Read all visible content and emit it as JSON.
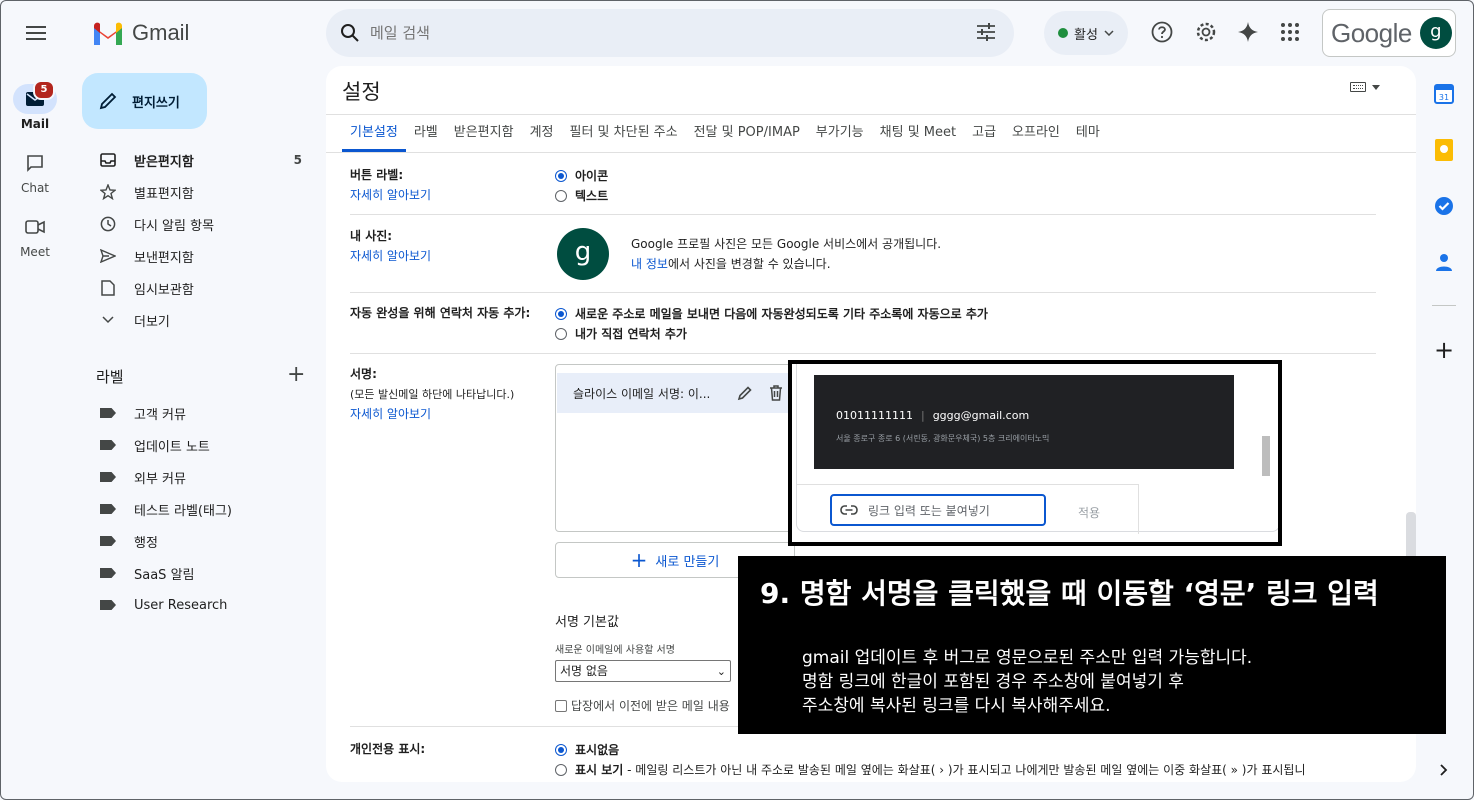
{
  "brand": {
    "name": "Gmail"
  },
  "rail": [
    {
      "label": "Mail",
      "badge": "5"
    },
    {
      "label": "Chat"
    },
    {
      "label": "Meet"
    }
  ],
  "search": {
    "placeholder": "메일 검색"
  },
  "status": {
    "label": "활성"
  },
  "account": {
    "google_word": "Google",
    "avatar_letter": "g"
  },
  "compose": {
    "label": "편지쓰기"
  },
  "nav": {
    "items": [
      {
        "label": "받은편지함",
        "count": "5"
      },
      {
        "label": "별표편지함"
      },
      {
        "label": "다시 알림 항목"
      },
      {
        "label": "보낸편지함"
      },
      {
        "label": "임시보관함"
      },
      {
        "label": "더보기"
      }
    ],
    "labels_header": "라벨",
    "labels": [
      "고객 커뮤",
      "업데이트 노트",
      "외부 커뮤",
      "테스트 라벨(태그)",
      "행정",
      "SaaS 알림",
      "User Research"
    ]
  },
  "settings": {
    "title": "설정",
    "tabs": [
      "기본설정",
      "라벨",
      "받은편지함",
      "계정",
      "필터 및 차단된 주소",
      "전달 및 POP/IMAP",
      "부가기능",
      "채팅 및 Meet",
      "고급",
      "오프라인",
      "테마"
    ],
    "learn_more": "자세히 알아보기",
    "button_label": {
      "title": "버튼 라벨:",
      "opt1": "아이콘",
      "opt2": "텍스트"
    },
    "photo": {
      "title": "내 사진:",
      "letter": "g",
      "line1": "Google 프로필 사진은 모든 Google 서비스에서 공개됩니다.",
      "link": "내 정보",
      "line2_rest": "에서 사진을 변경할 수 있습니다."
    },
    "autocomplete": {
      "title": "자동 완성을 위해 연락처 자동 추가:",
      "opt1": "새로운 주소로 메일을 보내면 다음에 자동완성되도록 기타 주소록에 자동으로 추가",
      "opt2": "내가 직접 연락처 추가"
    },
    "signature": {
      "title": "서명:",
      "subtitle": "(모든 발신메일 하단에 나타납니다.)",
      "item": "슬라이스 이메일 서명: 이...",
      "new_button": "새로 만들기",
      "defaults_title": "서명 기본값",
      "defaults_note": "새로운 이메일에 사용할 서명",
      "select_value": "서명 없음",
      "reply_checkbox": "답장에서 이전에 받은 메일 내용"
    },
    "personal": {
      "title": "개인전용 표시:",
      "opt1": "표시없음",
      "opt2_bold": "표시 보기",
      "opt2_rest": " - 메일링 리스트가 아닌 내 주소로 발송된 메일 옆에는 화살표( › )가 표시되고 나에게만 발송된 메일 옆에는 이중 화살표( » )가 표시됩니"
    }
  },
  "popup": {
    "phone": "01011111111",
    "email": "gggg@gmail.com",
    "address": "서울 종로구 종로 6 (서린동, 광화문우체국) 5층 크리에이터노믹",
    "link_placeholder": "링크 입력 또는 붙여넣기",
    "apply": "적용"
  },
  "instruction": {
    "title": "9. 명함 서명을 클릭했을 때 이동할 ‘영문’ 링크 입력",
    "lines": [
      "gmail 업데이트 후 버그로 영문으로된 주소만 입력 가능합니다.",
      "명함 링크에 한글이 포함된 경우 주소창에 붙여넣기 후",
      "주소창에 복사된 링크를 다시 복사해주세요."
    ]
  }
}
